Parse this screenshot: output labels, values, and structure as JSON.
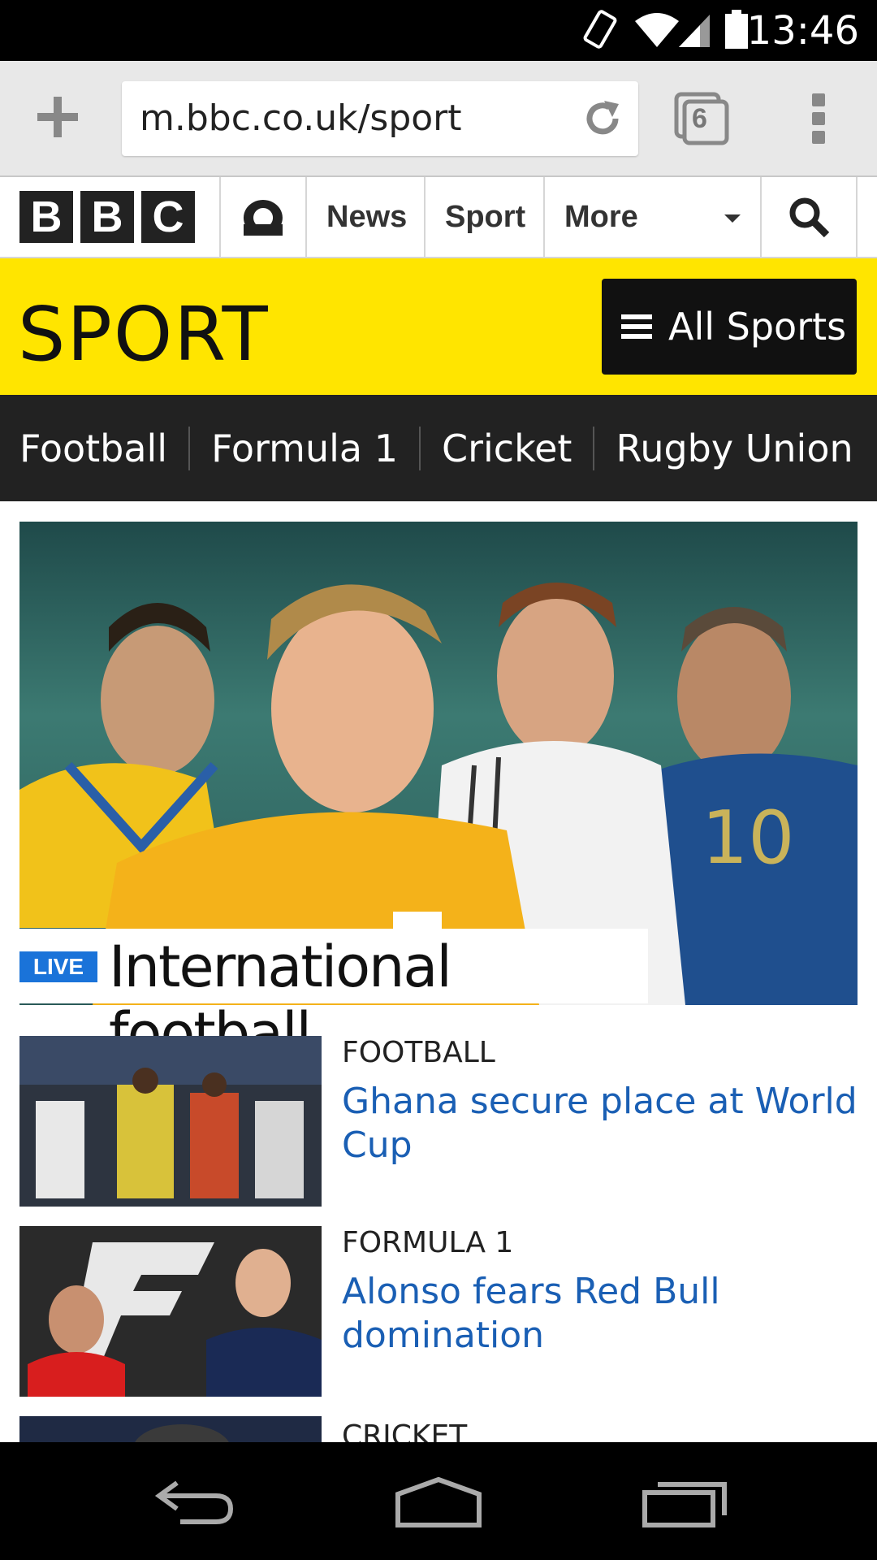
{
  "status_bar": {
    "time": "13:46",
    "icons": [
      "rotate-icon",
      "wifi-icon",
      "signal-icon",
      "battery-icon"
    ]
  },
  "browser": {
    "url": "m.bbc.co.uk/sport",
    "tab_count": "6"
  },
  "bbc_nav": {
    "logo_letters": [
      "B",
      "B",
      "C"
    ],
    "items": [
      "News",
      "Sport",
      "More"
    ]
  },
  "sport_header": {
    "logo_text": "SPORT",
    "all_sports_label": "All Sports"
  },
  "sports_nav": {
    "items": [
      "Football",
      "Formula 1",
      "Cricket",
      "Rugby Union"
    ]
  },
  "hero": {
    "badge": "LIVE",
    "title": "International football"
  },
  "stories": [
    {
      "category": "FOOTBALL",
      "headline": "Ghana secure place at World Cup"
    },
    {
      "category": "FORMULA 1",
      "headline": "Alonso fears Red Bull domination"
    },
    {
      "category": "CRICKET",
      "headline": ""
    }
  ],
  "colors": {
    "sport_yellow": "#ffe500",
    "nav_dark": "#222222",
    "live_blue": "#1a73d9",
    "headline_blue": "#1a5fb4"
  }
}
